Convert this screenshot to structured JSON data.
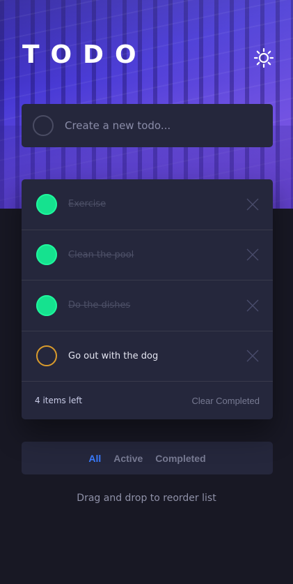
{
  "header": {
    "title": "TODO",
    "theme_toggle_icon": "sun-icon"
  },
  "new_todo": {
    "placeholder": "Create a new todo..."
  },
  "todos": [
    {
      "text": "Exercise",
      "completed": true
    },
    {
      "text": "Clean the pool",
      "completed": true
    },
    {
      "text": "Do the dishes",
      "completed": true
    },
    {
      "text": "Go out with the dog",
      "completed": false
    }
  ],
  "footer": {
    "items_left": "4 items left",
    "clear_label": "Clear Completed"
  },
  "filters": {
    "all": "All",
    "active": "Active",
    "completed": "Completed",
    "selected": "All"
  },
  "hint": "Drag and drop to reorder list",
  "colors": {
    "accent": "#3a7bfd",
    "check_done": "#15e28f",
    "check_open_border": "#d99b2c",
    "panel": "#25273c",
    "background": "#181824"
  }
}
